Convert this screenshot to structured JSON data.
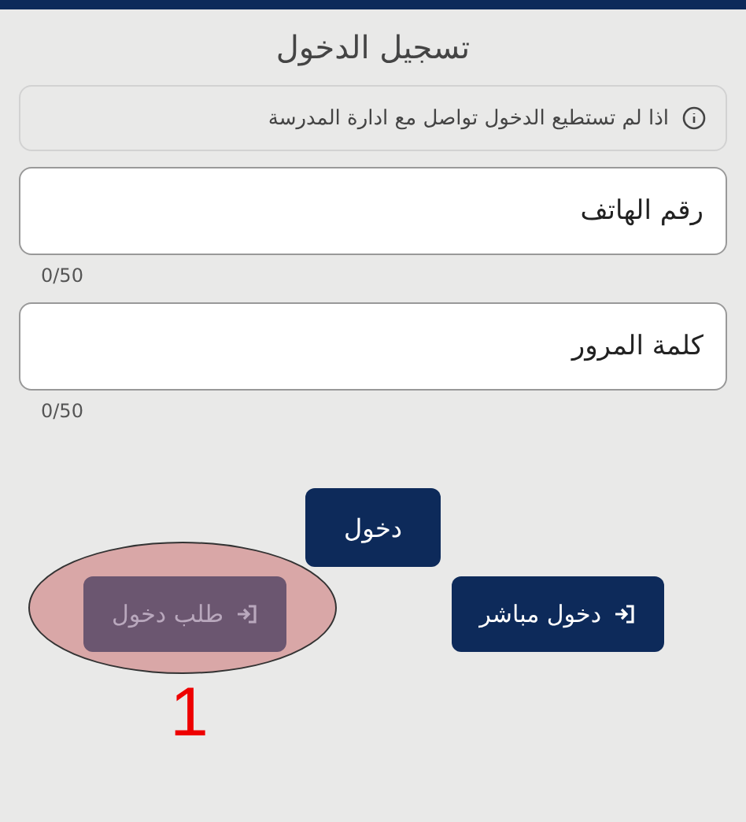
{
  "title": "تسجيل الدخول",
  "notice": "اذا لم تستطيع الدخول تواصل مع ادارة المدرسة",
  "fields": [
    {
      "placeholder": "رقم الهاتف",
      "counter": "0/50"
    },
    {
      "placeholder": "كلمة المرور",
      "counter": "0/50"
    }
  ],
  "login_button": "دخول",
  "actions": [
    {
      "label": "دخول مباشر",
      "disabled": false,
      "highlighted": false
    },
    {
      "label": "طلب دخول",
      "disabled": true,
      "highlighted": true
    }
  ],
  "annotation": {
    "number": "1"
  }
}
